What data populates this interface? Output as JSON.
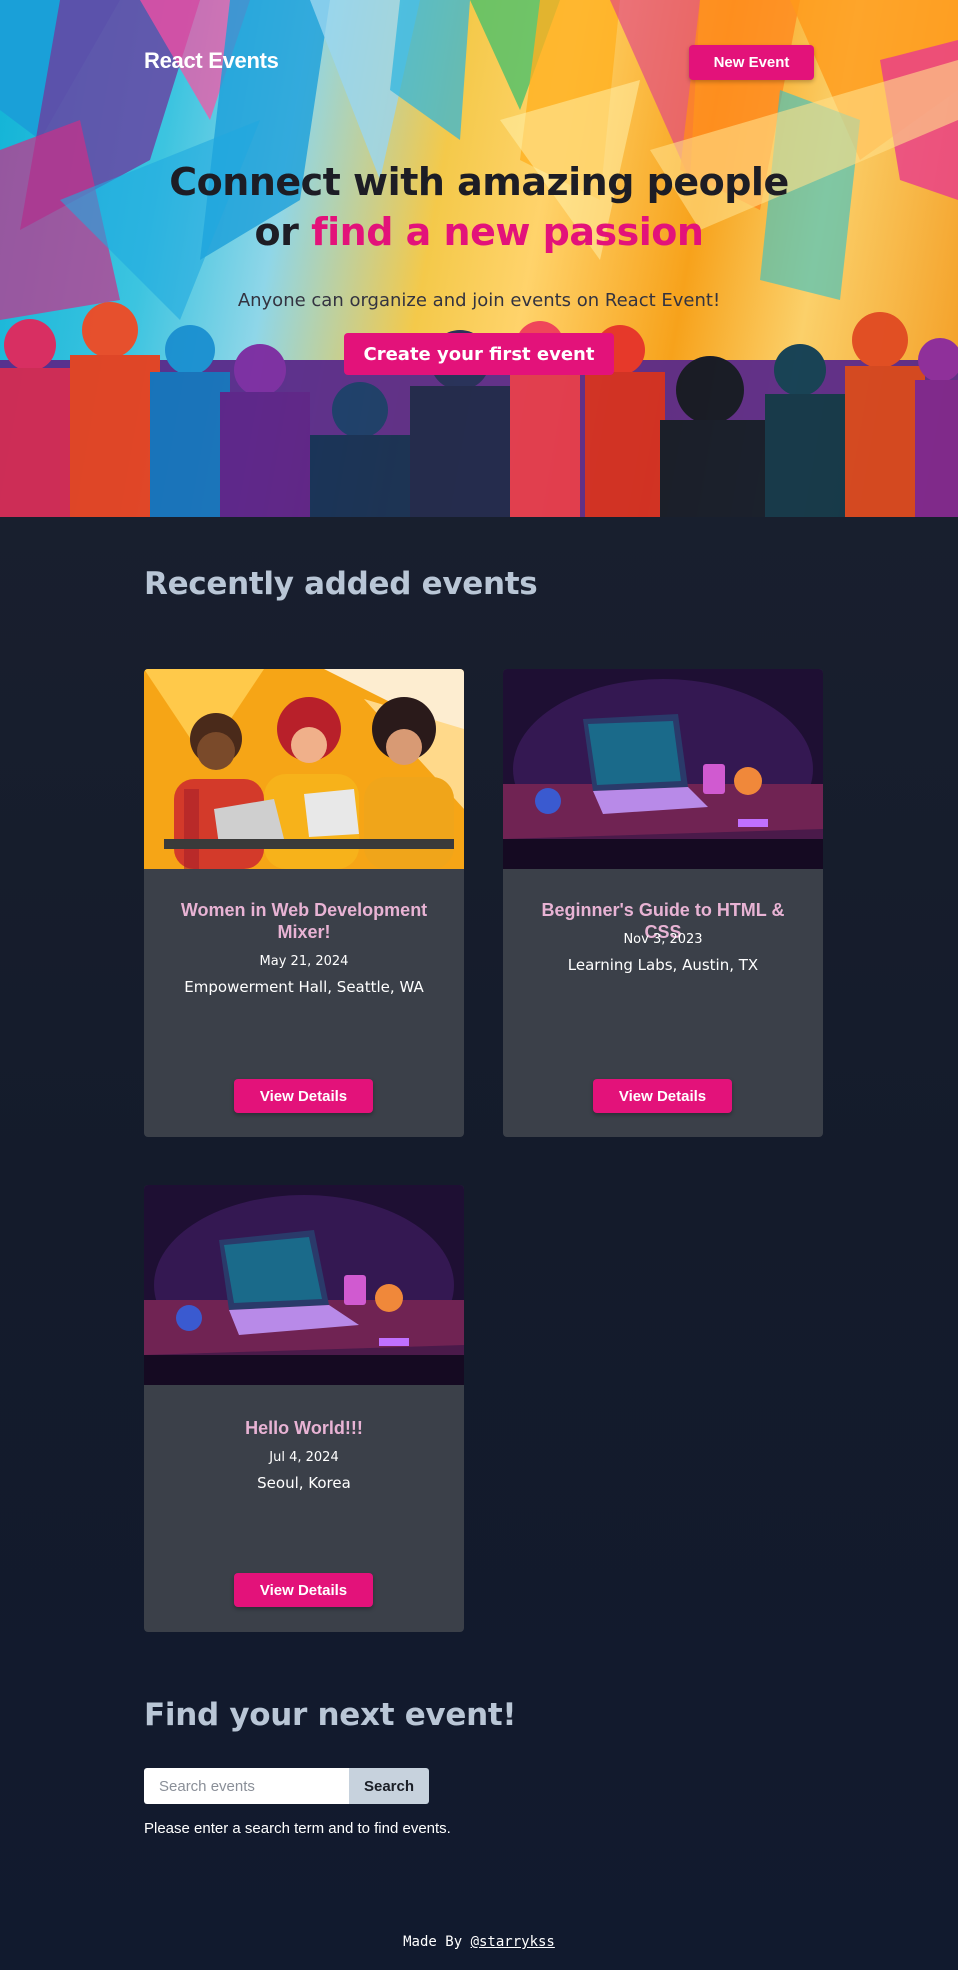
{
  "header": {
    "brand": "React Events",
    "new_event_label": "New Event"
  },
  "hero": {
    "title_line1": "Connect with amazing people",
    "title_line2_prefix": "or ",
    "title_line2_accent": "find a new passion",
    "subtitle": "Anyone can organize and join events on React Event!",
    "cta_label": "Create your first event"
  },
  "recent": {
    "heading": "Recently added events",
    "events": [
      {
        "title": "Women in Web Development Mixer!",
        "date": "May 21, 2024",
        "location": "Empowerment Hall, Seattle, WA",
        "button": "View Details"
      },
      {
        "title": "Beginner's Guide to HTML & CSS",
        "date": "Nov 3, 2023",
        "location": "Learning Labs, Austin, TX",
        "button": "View Details"
      },
      {
        "title": "Hello World!!!",
        "date": "Jul 4, 2024",
        "location": "Seoul, Korea",
        "button": "View Details"
      }
    ]
  },
  "search": {
    "heading": "Find your next event!",
    "placeholder": "Search events",
    "button_label": "Search",
    "hint": "Please enter a search term and to find events."
  },
  "footer": {
    "prefix": "Made By ",
    "link_text": "@starrykss"
  },
  "colors": {
    "accent": "#e3127a",
    "card_bg": "#3b4049",
    "page_bg": "#141b2b",
    "heading": "#b9c6d6",
    "card_title": "#e8b3d4"
  }
}
